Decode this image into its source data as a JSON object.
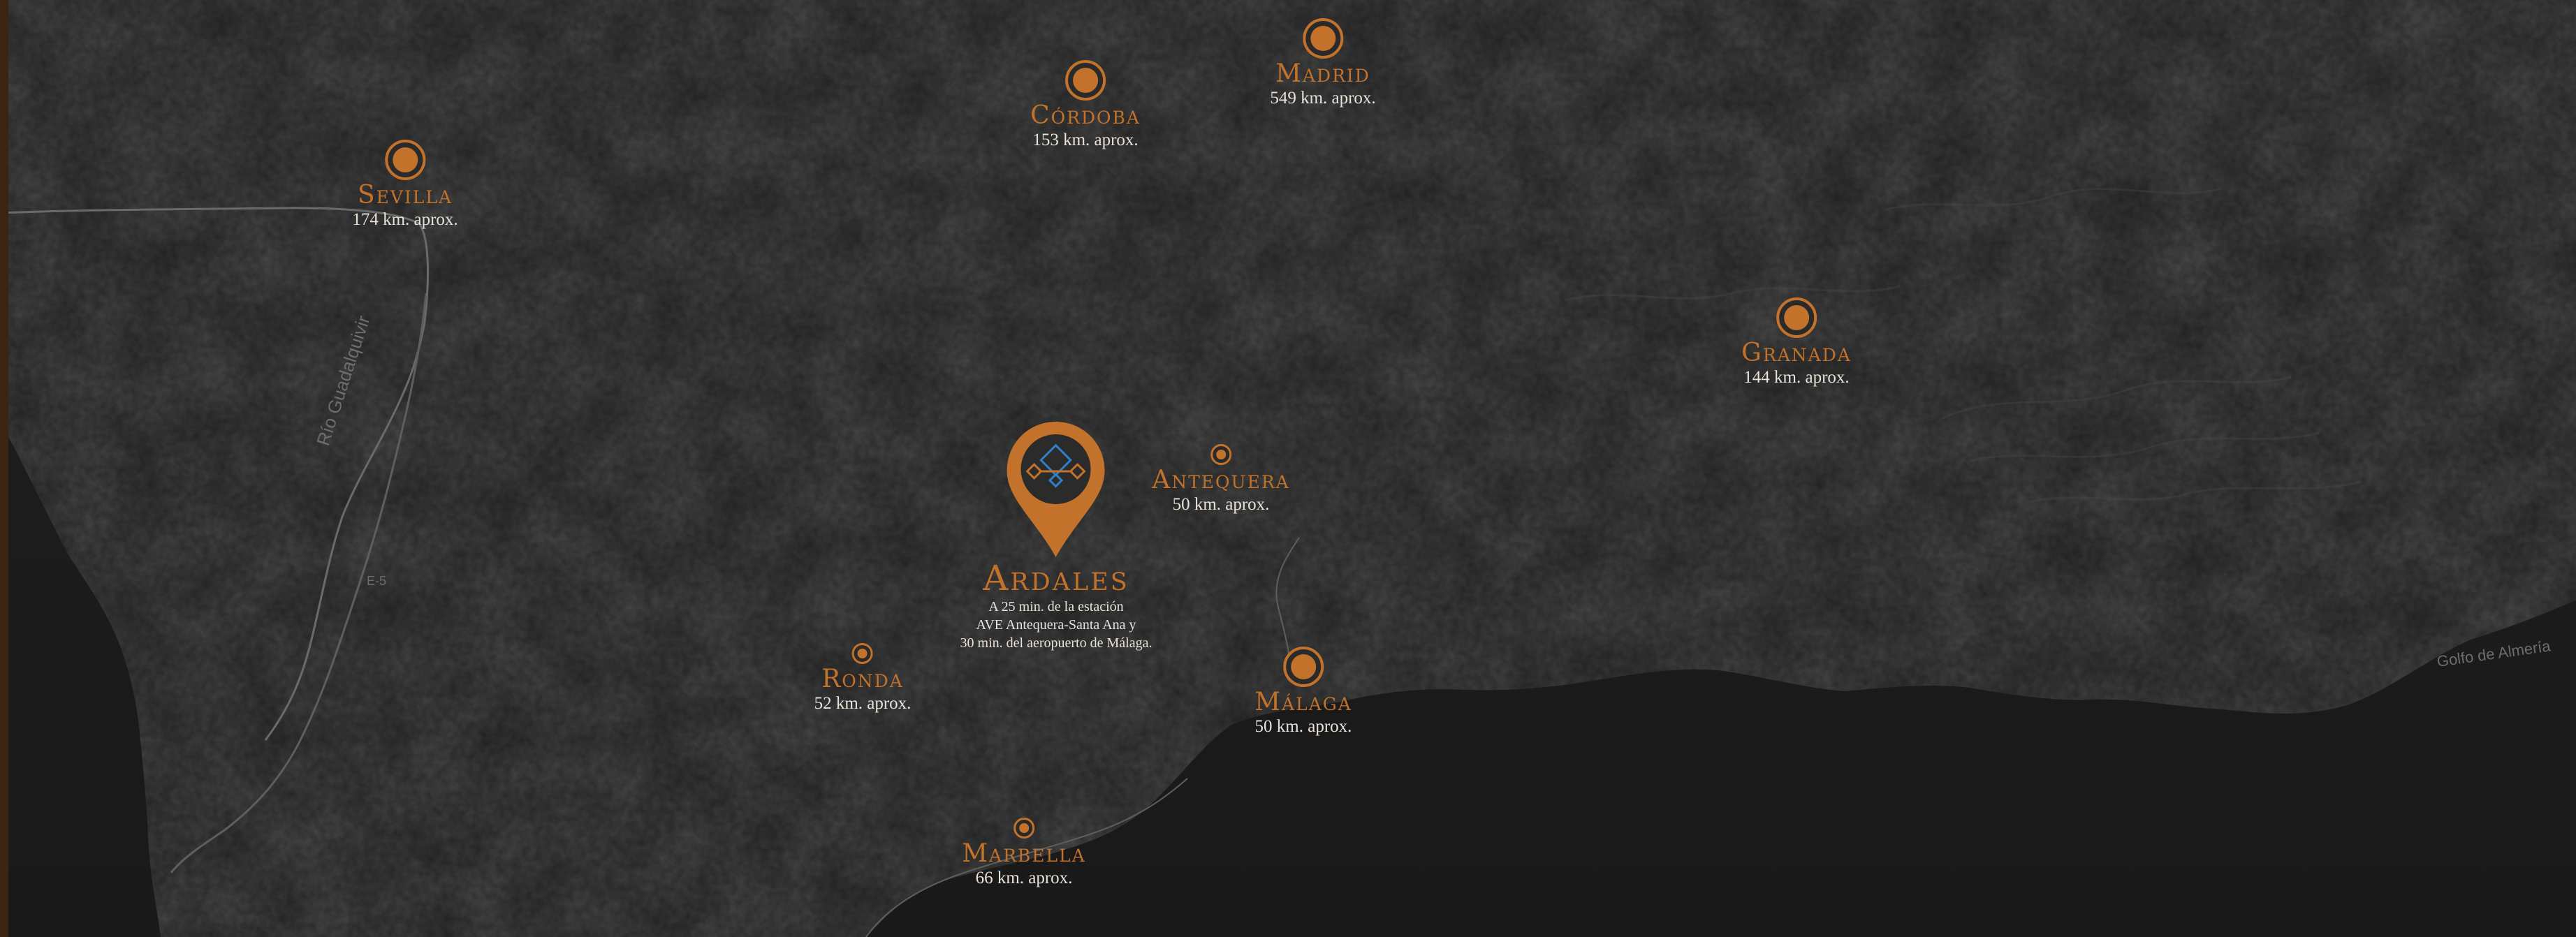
{
  "map": {
    "colors": {
      "accent": "#c2722a",
      "text": "#e9e2d8",
      "land": "#2b2b2b",
      "sea": "#1c1c1c",
      "road": "#6a6a6a",
      "logo_blue": "#2f80c8"
    },
    "base_labels": {
      "river": "Río Guadalquivir",
      "road": "E-5",
      "gulf": "Golfo de Almería"
    }
  },
  "cities": {
    "sevilla": {
      "name": "Sevilla",
      "distance": "174 km. aprox."
    },
    "cordoba": {
      "name": "Córdoba",
      "distance": "153 km. aprox."
    },
    "madrid": {
      "name": "Madrid",
      "distance": "549 km. aprox."
    },
    "granada": {
      "name": "Granada",
      "distance": "144 km. aprox."
    },
    "antequera": {
      "name": "Antequera",
      "distance": "50 km. aprox."
    },
    "ronda": {
      "name": "Ronda",
      "distance": "52 km. aprox."
    },
    "malaga": {
      "name": "Málaga",
      "distance": "50 km. aprox."
    },
    "marbella": {
      "name": "Marbella",
      "distance": "66 km. aprox."
    }
  },
  "ardales": {
    "name": "Ardales",
    "note_lines": [
      "A 25 min. de la estación",
      "AVE Antequera-Santa Ana y",
      "30 min. del aeropuerto de Málaga."
    ],
    "pin_icon": "map-pin-logo-icon"
  }
}
